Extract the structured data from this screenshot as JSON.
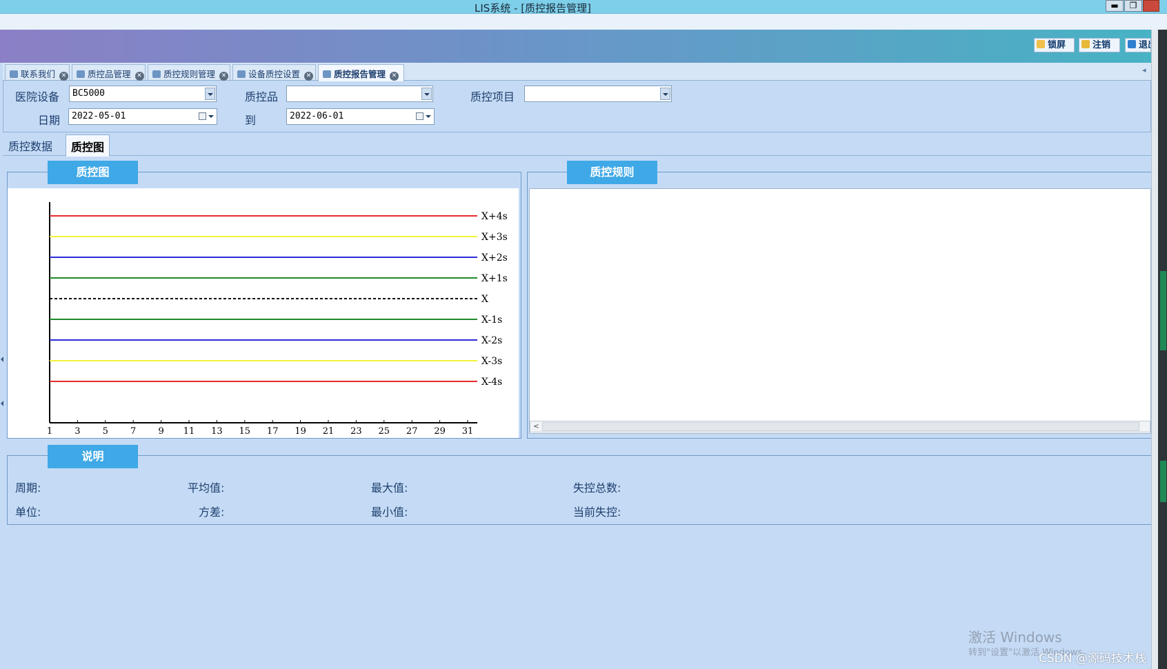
{
  "window": {
    "title": "LIS系统 - [质控报告管理]",
    "minimize": "▬",
    "restore": "❐",
    "close": ""
  },
  "toolbar": {
    "lock_label": "锁屏",
    "logout_label": "注销",
    "exit_label": "退出"
  },
  "tabs": [
    {
      "label": "联系我们",
      "close": "✕"
    },
    {
      "label": "质控品管理",
      "close": "✕"
    },
    {
      "label": "质控规则管理",
      "close": "✕"
    },
    {
      "label": "设备质控设置",
      "close": "✕"
    },
    {
      "label": "质控报告管理",
      "close": "✕",
      "active": true
    }
  ],
  "tab_scroll_arrow": "◂",
  "filters": {
    "device_label": "医院设备",
    "device_value": "BC5000",
    "qc_product_label": "质控品",
    "qc_product_value": "",
    "qc_item_label": "质控项目",
    "qc_item_value": "",
    "date_label": "日期",
    "date_from": "2022-05-01",
    "to_label": "到",
    "date_to": "2022-06-01"
  },
  "subtabs": [
    {
      "label": "质控数据",
      "active": false
    },
    {
      "label": "质控图",
      "active": true
    }
  ],
  "chart_panel": {
    "title": "质控图"
  },
  "rules_panel": {
    "title": "质控规则",
    "scroll_left": "<"
  },
  "chart_data": {
    "type": "line",
    "x_ticks": [
      "1",
      "3",
      "5",
      "7",
      "9",
      "11",
      "13",
      "15",
      "17",
      "19",
      "21",
      "23",
      "25",
      "27",
      "29",
      "31"
    ],
    "xlim": [
      1,
      31
    ],
    "series": [
      {
        "name": "X+4s",
        "level": 4,
        "color": "#e52b2b",
        "style": "solid"
      },
      {
        "name": "X+3s",
        "level": 3,
        "color": "#f2f23a",
        "style": "solid"
      },
      {
        "name": "X+2s",
        "level": 2,
        "color": "#2a2ad6",
        "style": "solid"
      },
      {
        "name": "X+1s",
        "level": 1,
        "color": "#1e8a2a",
        "style": "solid"
      },
      {
        "name": "X",
        "level": 0,
        "color": "#000000",
        "style": "dashed"
      },
      {
        "name": "X-1s",
        "level": -1,
        "color": "#1e8a2a",
        "style": "solid"
      },
      {
        "name": "X-2s",
        "level": -2,
        "color": "#2a2ad6",
        "style": "solid"
      },
      {
        "name": "X-3s",
        "level": -3,
        "color": "#f2f23a",
        "style": "solid"
      },
      {
        "name": "X-4s",
        "level": -4,
        "color": "#e52b2b",
        "style": "solid"
      }
    ],
    "data_points": []
  },
  "info": {
    "title": "说明",
    "period_label": "周期:",
    "mean_label": "平均值:",
    "max_label": "最大值:",
    "out_total_label": "失控总数:",
    "unit_label": "单位:",
    "variance_label": "方差:",
    "min_label": "最小值:",
    "current_out_label": "当前失控:"
  },
  "watermark": {
    "activate": "激活 Windows",
    "activate_sub": "转到\"设置\"以激活 Windows。",
    "csdn": "CSDN @源码技术栈"
  },
  "colors": {
    "header_blue": "#3fa8e6",
    "panel_bg": "#c5dbf5"
  }
}
